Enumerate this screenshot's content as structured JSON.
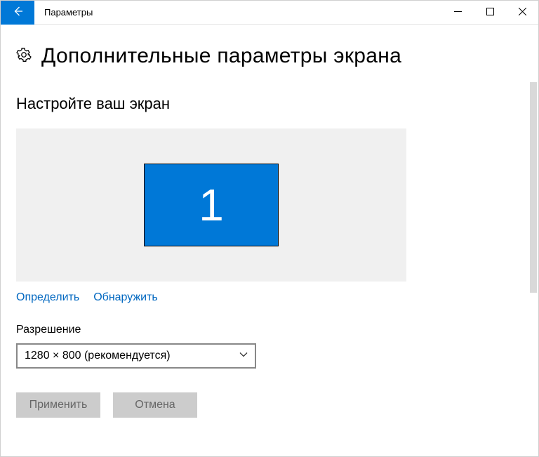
{
  "titlebar": {
    "app_title": "Параметры"
  },
  "page": {
    "title": "Дополнительные параметры экрана",
    "section_title": "Настройте ваш экран",
    "monitor_number": "1",
    "links": {
      "identify": "Определить",
      "detect": "Обнаружить"
    },
    "resolution": {
      "label": "Разрешение",
      "value": "1280 × 800 (рекомендуется)"
    },
    "buttons": {
      "apply": "Применить",
      "cancel": "Отмена"
    }
  },
  "colors": {
    "accent": "#0078d7",
    "link": "#0067c0"
  }
}
